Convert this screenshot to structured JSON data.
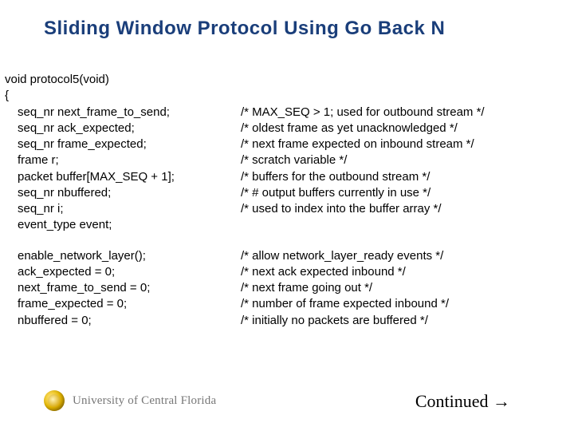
{
  "title": "Sliding Window Protocol Using Go Back N",
  "code": {
    "l1": "void protocol5(void)",
    "l2": "{",
    "d1": {
      "left": "seq_nr next_frame_to_send;",
      "right": "/* MAX_SEQ > 1; used for outbound stream */"
    },
    "d2": {
      "left": "seq_nr ack_expected;",
      "right": "/* oldest frame as yet unacknowledged */"
    },
    "d3": {
      "left": "seq_nr frame_expected;",
      "right": "/* next frame expected on inbound stream */"
    },
    "d4": {
      "left": "frame r;",
      "right": "/* scratch variable */"
    },
    "d5": {
      "left": "packet buffer[MAX_SEQ + 1];",
      "right": "/* buffers for the outbound stream */"
    },
    "d6": {
      "left": "seq_nr nbuffered;",
      "right": "/* # output buffers currently in use */"
    },
    "d7": {
      "left": "seq_nr i;",
      "right": "/* used to index into the buffer array */"
    },
    "d8": {
      "left": "event_type event;",
      "right": ""
    },
    "s1": {
      "left": "enable_network_layer();",
      "right": "/* allow network_layer_ready events */"
    },
    "s2": {
      "left": "ack_expected = 0;",
      "right": "/* next ack expected inbound */"
    },
    "s3": {
      "left": "next_frame_to_send = 0;",
      "right": "/* next frame going out */"
    },
    "s4": {
      "left": "frame_expected = 0;",
      "right": "/* number of frame expected inbound */"
    },
    "s5": {
      "left": "nbuffered = 0;",
      "right": "/* initially no packets are buffered */"
    }
  },
  "footer": {
    "university": "University of Central Florida",
    "continued": "Continued →"
  }
}
